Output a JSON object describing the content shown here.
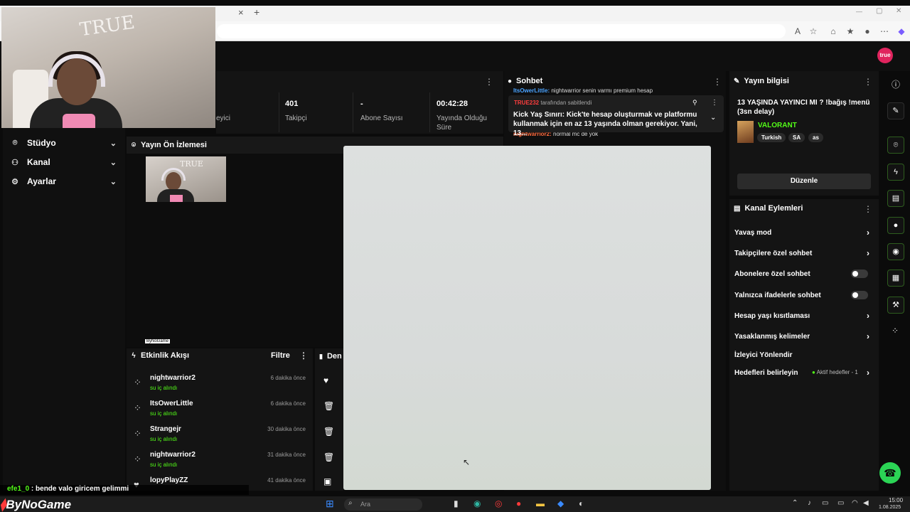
{
  "app": {
    "avatar_label": "true"
  },
  "browser": {
    "tab_close": "×",
    "tab_new": "+",
    "window_minimize": "—",
    "window_maximize": "▢",
    "window_close": "✕"
  },
  "sidebar": {
    "items": [
      {
        "label": "Stüdyo",
        "icon": "studio-icon"
      },
      {
        "label": "Kanal",
        "icon": "channel-icon"
      },
      {
        "label": "Ayarlar",
        "icon": "gear-icon"
      }
    ]
  },
  "stats": [
    {
      "value": "",
      "label": "eyici"
    },
    {
      "value": "401",
      "label": "Takipçi"
    },
    {
      "value": "-",
      "label": "Abone Sayısı"
    },
    {
      "value": "00:42:28",
      "label": "Yayında Olduğu Süre"
    }
  ],
  "preview": {
    "title": "Yayın Ön İzlemesi",
    "watermark": "ByNoGame"
  },
  "feed": {
    "title": "Etkinlik Akışı",
    "filter_label": "Filtre",
    "items": [
      {
        "name": "nightwarrior2",
        "action": "su iç alındı",
        "time": "6 dakika önce"
      },
      {
        "name": "ItsOwerLittle",
        "action": "su iç alındı",
        "time": "6 dakika önce"
      },
      {
        "name": "Strangejr",
        "action": "su iç alındı",
        "time": "30 dakika önce"
      },
      {
        "name": "nightwarrior2",
        "action": "su iç alındı",
        "time": "31 dakika önce"
      },
      {
        "name": "lopyPlayZZ",
        "action": "",
        "time": "41 dakika önce"
      }
    ]
  },
  "list2": {
    "title": "Den"
  },
  "chat": {
    "title": "Sohbet",
    "top_line_user": "ItsOwerLittle:",
    "top_line_text": "nightwarrior senin varmı premium hesap",
    "pinned_by": "TRUE232",
    "pinned_suffix": "tarafından sabitlendi",
    "pinned_text": "Kick Yaş Sınırı: Kick'te hesap oluşturmak ve platformu kullanmak için en az 13 yaşında olman gerekiyor. Yani, 13...",
    "bottom_line_user": "nightwarrior2:",
    "bottom_line_text": "normal mc de yok"
  },
  "info": {
    "title": "Yayın bilgisi",
    "stream_title": "13 YAŞINDA YAYINCI MI ? !bağış !menü (3sn delay)",
    "category": "VALORANT",
    "tags": [
      "Turkish",
      "SA",
      "as"
    ],
    "edit_label": "Düzenle"
  },
  "actions": {
    "title": "Kanal Eylemleri",
    "rows": [
      {
        "label": "Yavaş mod",
        "kind": "chevron"
      },
      {
        "label": "Takipçilere özel sohbet",
        "kind": "chevron"
      },
      {
        "label": "Abonelere özel sohbet",
        "kind": "toggle"
      },
      {
        "label": "Yalnızca ifadelerle sohbet",
        "kind": "toggle"
      },
      {
        "label": "Hesap yaşı kısıtlaması",
        "kind": "chevron"
      },
      {
        "label": "Yasaklanmış kelimeler",
        "kind": "chevron"
      },
      {
        "label": "İzleyici Yönlendir",
        "kind": "none"
      },
      {
        "label": "Hedefleri belirleyin",
        "kind": "goal"
      }
    ],
    "goal_status": "Aktif hedefler - 1"
  },
  "stream_chat": {
    "user": "efe1_0",
    "text": ": bende valo giricem gelimmi"
  },
  "brand": "ByNoGame",
  "taskbar": {
    "search_placeholder": "Ara",
    "time": "15:00",
    "date": "1.08.2025"
  },
  "colors": {
    "accent": "#53fc18",
    "panel": "#141414",
    "background": "#0b0b0b",
    "avatar": "#e0245e"
  }
}
